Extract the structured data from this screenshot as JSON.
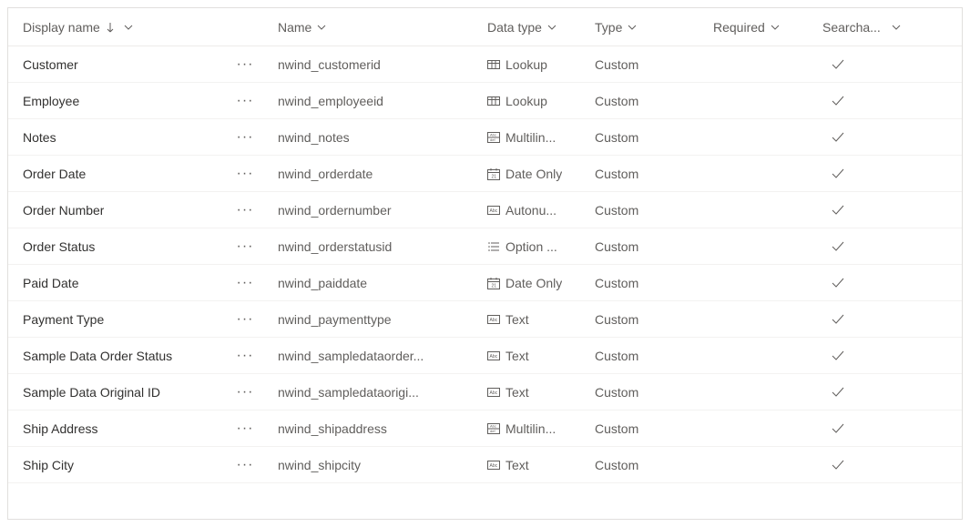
{
  "columns": {
    "display_name": "Display name",
    "name": "Name",
    "data_type": "Data type",
    "type": "Type",
    "required": "Required",
    "searchable": "Searcha..."
  },
  "sort": {
    "column": "display_name",
    "direction": "asc"
  },
  "icons": {
    "lookup": "lookup",
    "multiline": "multiline",
    "dateonly": "dateonly",
    "autonum": "autonum",
    "optionset": "optionset",
    "text": "text"
  },
  "rows": [
    {
      "display_name": "Customer",
      "name": "nwind_customerid",
      "data_type_icon": "lookup",
      "data_type": "Lookup",
      "type": "Custom",
      "required": false,
      "searchable": true
    },
    {
      "display_name": "Employee",
      "name": "nwind_employeeid",
      "data_type_icon": "lookup",
      "data_type": "Lookup",
      "type": "Custom",
      "required": false,
      "searchable": true
    },
    {
      "display_name": "Notes",
      "name": "nwind_notes",
      "data_type_icon": "multiline",
      "data_type": "Multilin...",
      "type": "Custom",
      "required": false,
      "searchable": true
    },
    {
      "display_name": "Order Date",
      "name": "nwind_orderdate",
      "data_type_icon": "dateonly",
      "data_type": "Date Only",
      "type": "Custom",
      "required": false,
      "searchable": true
    },
    {
      "display_name": "Order Number",
      "name": "nwind_ordernumber",
      "data_type_icon": "autonum",
      "data_type": "Autonu...",
      "type": "Custom",
      "required": false,
      "searchable": true
    },
    {
      "display_name": "Order Status",
      "name": "nwind_orderstatusid",
      "data_type_icon": "optionset",
      "data_type": "Option ...",
      "type": "Custom",
      "required": false,
      "searchable": true
    },
    {
      "display_name": "Paid Date",
      "name": "nwind_paiddate",
      "data_type_icon": "dateonly",
      "data_type": "Date Only",
      "type": "Custom",
      "required": false,
      "searchable": true
    },
    {
      "display_name": "Payment Type",
      "name": "nwind_paymenttype",
      "data_type_icon": "text",
      "data_type": "Text",
      "type": "Custom",
      "required": false,
      "searchable": true
    },
    {
      "display_name": "Sample Data Order Status",
      "name": "nwind_sampledataorder...",
      "data_type_icon": "text",
      "data_type": "Text",
      "type": "Custom",
      "required": false,
      "searchable": true
    },
    {
      "display_name": "Sample Data Original ID",
      "name": "nwind_sampledataorigi...",
      "data_type_icon": "text",
      "data_type": "Text",
      "type": "Custom",
      "required": false,
      "searchable": true
    },
    {
      "display_name": "Ship Address",
      "name": "nwind_shipaddress",
      "data_type_icon": "multiline",
      "data_type": "Multilin...",
      "type": "Custom",
      "required": false,
      "searchable": true
    },
    {
      "display_name": "Ship City",
      "name": "nwind_shipcity",
      "data_type_icon": "text",
      "data_type": "Text",
      "type": "Custom",
      "required": false,
      "searchable": true
    }
  ]
}
